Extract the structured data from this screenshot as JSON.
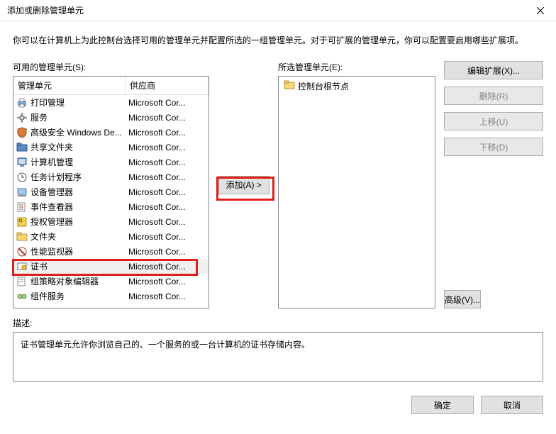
{
  "window": {
    "title": "添加或删除管理单元"
  },
  "intro": "你可以在计算机上为此控制台选择可用的管理单元并配置所选的一组管理单元。对于可扩展的管理单元，你可以配置要启用哪些扩展项。",
  "available": {
    "label": "可用的管理单元(S):",
    "columns": {
      "name": "管理单元",
      "vendor": "供应商"
    },
    "items": [
      {
        "name": "打印管理",
        "vendor": "Microsoft Cor...",
        "icon": "printer"
      },
      {
        "name": "服务",
        "vendor": "Microsoft Cor...",
        "icon": "gear"
      },
      {
        "name": "高级安全 Windows De...",
        "vendor": "Microsoft Cor...",
        "icon": "shield"
      },
      {
        "name": "共享文件夹",
        "vendor": "Microsoft Cor...",
        "icon": "folder"
      },
      {
        "name": "计算机管理",
        "vendor": "Microsoft Cor...",
        "icon": "computer"
      },
      {
        "name": "任务计划程序",
        "vendor": "Microsoft Cor...",
        "icon": "clock"
      },
      {
        "name": "设备管理器",
        "vendor": "Microsoft Cor...",
        "icon": "device"
      },
      {
        "name": "事件查看器",
        "vendor": "Microsoft Cor...",
        "icon": "event"
      },
      {
        "name": "授权管理器",
        "vendor": "Microsoft Cor...",
        "icon": "key"
      },
      {
        "name": "文件夹",
        "vendor": "Microsoft Cor...",
        "icon": "folder-plain"
      },
      {
        "name": "性能监视器",
        "vendor": "Microsoft Cor...",
        "icon": "perf"
      },
      {
        "name": "证书",
        "vendor": "Microsoft Cor...",
        "icon": "cert",
        "selected": true
      },
      {
        "name": "组策略对象编辑器",
        "vendor": "Microsoft Cor...",
        "icon": "policy"
      },
      {
        "name": "组件服务",
        "vendor": "Microsoft Cor...",
        "icon": "component"
      }
    ]
  },
  "addButton": "添加(A) >",
  "selected": {
    "label": "所选管理单元(E):",
    "rootNode": "控制台根节点"
  },
  "sideButtons": {
    "editExtensions": "编辑扩展(X)...",
    "remove": "删除(R)",
    "moveUp": "上移(U)",
    "moveDown": "下移(D)",
    "advanced": "高级(V)..."
  },
  "description": {
    "label": "描述:",
    "text": "证书管理单元允许你浏览自己的、一个服务的或一台计算机的证书存储内容。"
  },
  "footer": {
    "ok": "确定",
    "cancel": "取消"
  }
}
